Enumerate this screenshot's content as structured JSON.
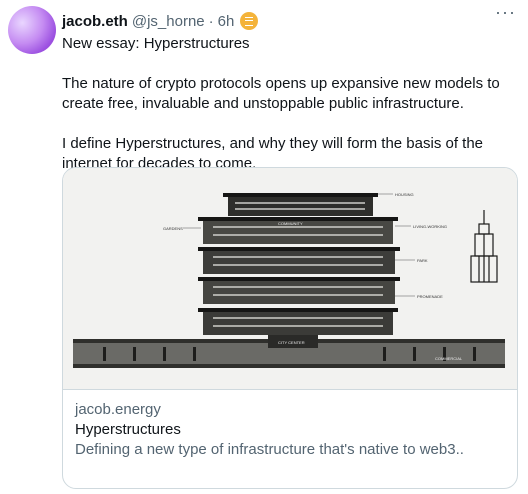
{
  "tweet": {
    "author_name": "jacob.eth",
    "handle": "@js_horne",
    "separator": "·",
    "time": "6h",
    "more_icon": "more-dots-icon",
    "paragraphs": [
      "New essay: Hyperstructures",
      "The nature of crypto protocols opens up expansive new models to create free, invaluable and unstoppable public infrastructure.",
      "I define Hyperstructures, and why they will form the basis of the internet for decades to come."
    ]
  },
  "card": {
    "image_icon": "hyperstructure-illustration",
    "domain": "jacob.energy",
    "title": "Hyperstructures",
    "description": "Defining a new type of infrastructure that's native to web3..",
    "image_labels": [
      "HOUSING",
      "GARDENS",
      "COMMUNITY",
      "LIVING-WORKING",
      "PARK",
      "PROMENADE",
      "CITY CENTER",
      "COMMERCIAL"
    ]
  },
  "colors": {
    "text": "#0f1419",
    "secondary": "#536471",
    "border": "#cfd9de",
    "badge": "#f4b33a"
  }
}
